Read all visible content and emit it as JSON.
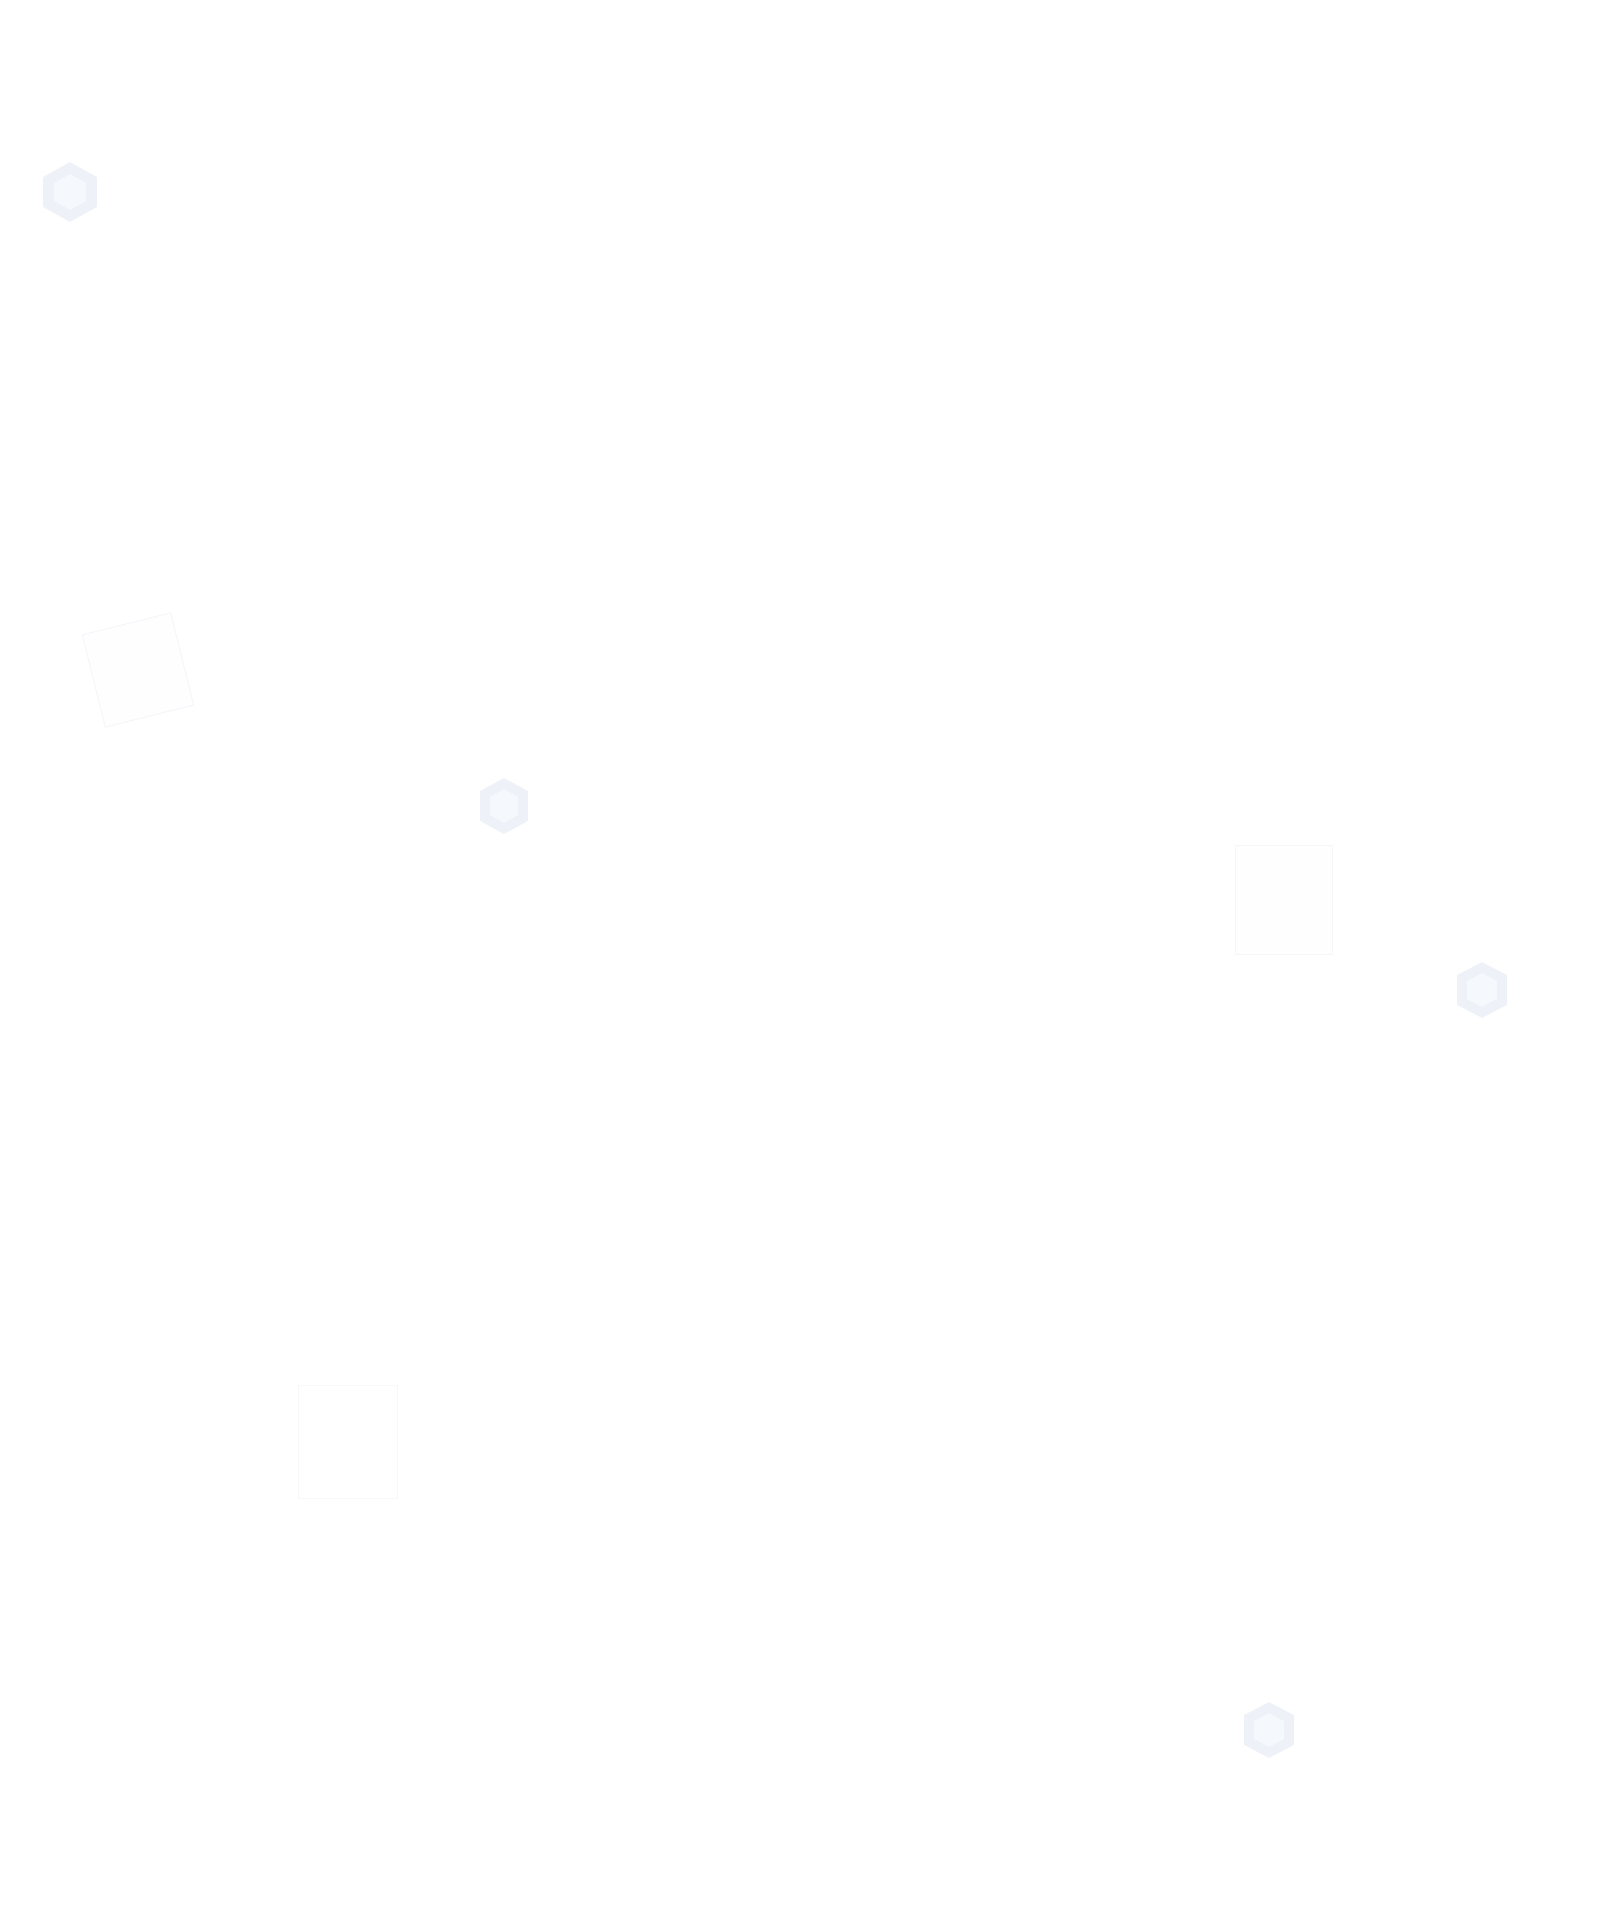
{
  "colors": {
    "background": "#ffffff",
    "hexagon_fill": "#eef2f8",
    "hexagon_inner": "#f5f8fc",
    "square_outline": "#f3f5f9"
  },
  "decorations": {
    "hexagon_icon": "hexagon-icon",
    "square_icon": "square-outline-icon"
  }
}
